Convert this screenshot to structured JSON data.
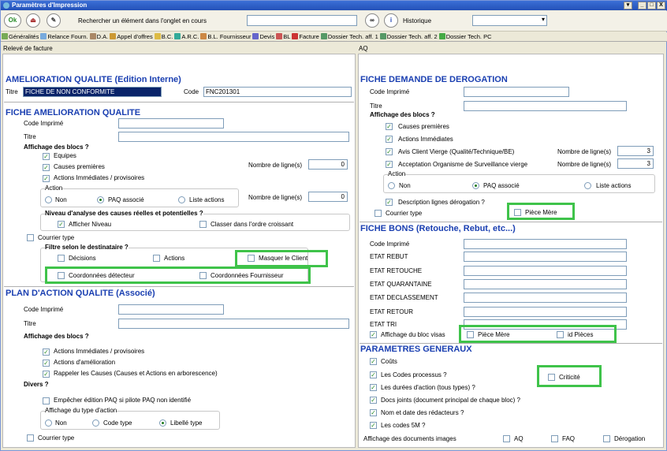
{
  "window": {
    "title": "Paramètres d'Impression",
    "min": "_",
    "max": "□",
    "close": "X",
    "restore": "▾"
  },
  "toolbar": {
    "ok": "Ok",
    "search_label": "Rechercher un élément dans l'onglet en cours",
    "history_label": "Historique"
  },
  "tabs": [
    "Généralités",
    "Relance Fourn.",
    "D.A.",
    "Appel d'offres",
    "B.C.",
    "A.R.C.",
    "B.L. Fournisseur",
    "Devis",
    "BL",
    "Facture",
    "Dossier Tech. aff. 1",
    "Dossier Tech. aff. 2",
    "Dossier Tech. PC"
  ],
  "headers": {
    "left": "Relevé de facture",
    "right": "AQ"
  },
  "left": {
    "aq_title": "AMELIORATION QUALITE (Edition Interne)",
    "titre_label": "Titre",
    "titre_value": "FICHE DE NON CONFORMITE",
    "code_label": "Code",
    "code_value": "FNC201301",
    "fiche_title": "FICHE AMELIORATION QUALITE",
    "code_imprime": "Code Imprimé",
    "titre": "Titre",
    "affichage": "Affichage des blocs ?",
    "equipes": "Equipes",
    "causes": "Causes premières",
    "actions_imm": "Actions Immédiates / provisoires",
    "nb_lignes": "Nombre de ligne(s)",
    "nb1": "0",
    "nb2": "0",
    "action": "Action",
    "non": "Non",
    "paq": "PAQ associé",
    "liste": "Liste actions",
    "niveau": "Niveau d'analyse des causes réelles et potentielles ?",
    "afficher_niveau": "Afficher Niveau",
    "classer": "Classer dans l'ordre croissant",
    "courrier": "Courrier type",
    "filtre": "Filtre selon le destinataire ?",
    "decisions": "Décisions",
    "actions": "Actions",
    "masquer": "Masquer le Client",
    "coord_det": "Coordonnées détecteur",
    "coord_four": "Coordonnées Fournisseur",
    "plan_title": "PLAN D'ACTION QUALITE (Associé)",
    "p_code": "Code Imprimé",
    "p_titre": "Titre",
    "p_aff": "Affichage des blocs ?",
    "p_actions_imm": "Actions Immédiates / provisoires",
    "p_actions_am": "Actions d'amélioration",
    "p_rappeler": "Rappeler les Causes (Causes et Actions en arborescence)",
    "divers": "Divers ?",
    "empecher": "Empêcher édition PAQ si pilote PAQ non identifié",
    "aff_type": "Affichage du type d'action",
    "non2": "Non",
    "code_type": "Code type",
    "libelle": "Libellé type",
    "courrier2": "Courrier type"
  },
  "right": {
    "derog_title": "FICHE DEMANDE DE DEROGATION",
    "code_imprime": "Code Imprimé",
    "titre": "Titre",
    "affichage": "Affichage des blocs ?",
    "causes": "Causes premières",
    "actions_imm": "Actions Immédiates",
    "avis": "Avis Client Vierge (Qualité/Technique/BE)",
    "accept": "Acceptation Organisme de Surveillance vierge",
    "nb_lignes": "Nombre de ligne(s)",
    "nb1": "3",
    "nb2": "3",
    "action": "Action",
    "non": "Non",
    "paq": "PAQ associé",
    "liste": "Liste actions",
    "desc": "Description lignes dérogation ?",
    "courrier": "Courrier type",
    "piece_mere": "Pièce Mère",
    "bons_title": "FICHE BONS (Retouche, Rebut, etc...)",
    "bons": [
      "Code Imprimé",
      "ETAT REBUT",
      "ETAT RETOUCHE",
      "ETAT QUARANTAINE",
      "ETAT DECLASSEMENT",
      "ETAT RETOUR",
      "ETAT TRI"
    ],
    "visas": "Affichage du bloc visas",
    "piece_mere2": "Pièce Mère",
    "id_pieces": "id Pièces",
    "param_title": "PARAMETRES GENERAUX",
    "couts": "Coûts",
    "codes_proc": "Les Codes processus ?",
    "criticite": "Criticité",
    "durees": "Les durées d'action (tous types) ?",
    "docs": "Docs joints (document principal de chaque bloc) ?",
    "nom": "Nom et date des rédacteurs ?",
    "codes5m": "Les codes 5M ?",
    "aff_docs": "Affichage des documents images",
    "aq": "AQ",
    "faq": "FAQ",
    "derog": "Dérogation"
  }
}
